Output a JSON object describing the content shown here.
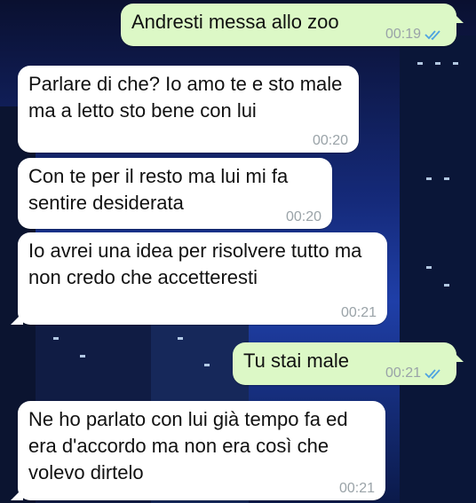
{
  "colors": {
    "incoming_bubble": "#ffffff",
    "outgoing_bubble": "#dcf8c6",
    "read_ticks": "#4fa3e0"
  },
  "messages": [
    {
      "direction": "out",
      "text": "Andresti messa allo zoo",
      "time": "00:19",
      "status": "read-ticks-icon"
    },
    {
      "direction": "in",
      "text": "Parlare di che?  Io amo te e sto male ma a letto sto bene con lui",
      "time": "00:20"
    },
    {
      "direction": "in",
      "text": "Con te per il resto ma lui mi fa sentire desiderata",
      "time": "00:20"
    },
    {
      "direction": "in",
      "text": "Io avrei una idea per risolvere tutto ma non credo che accetteresti",
      "time": "00:21"
    },
    {
      "direction": "out",
      "text": "Tu stai male",
      "time": "00:21",
      "status": "read-ticks-icon"
    },
    {
      "direction": "in",
      "text": "Ne ho parlato con lui già tempo fa ed era d'accordo ma non era così che volevo dirtelo",
      "time": "00:21"
    }
  ]
}
